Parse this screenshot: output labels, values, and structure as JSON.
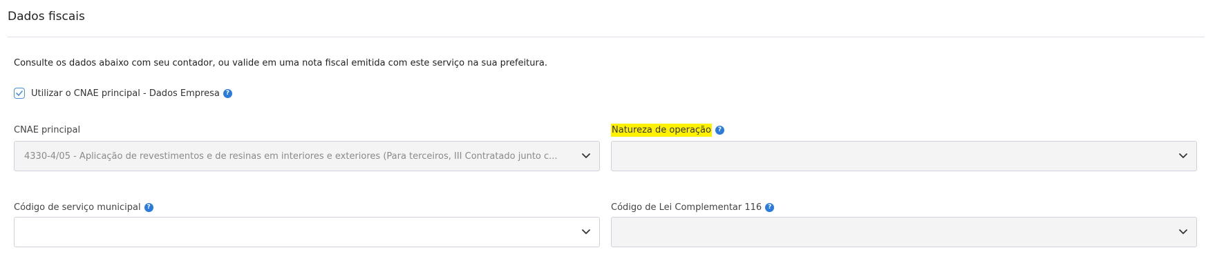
{
  "section": {
    "title": "Dados fiscais",
    "intro": "Consulte os dados abaixo com seu contador, ou valide em uma nota fiscal emitida com este serviço na sua prefeitura."
  },
  "cnae_checkbox": {
    "label": "Utilizar o CNAE principal - Dados Empresa",
    "checked": true
  },
  "fields": {
    "cnae_principal": {
      "label": "CNAE principal",
      "value": "4330-4/05 - Aplicação de revestimentos e de resinas em interiores e exteriores (Para terceiros, III Contratado junto c..."
    },
    "natureza_operacao": {
      "label": "Natureza de operação",
      "value": ""
    },
    "codigo_servico_municipal": {
      "label": "Código de serviço municipal",
      "value": ""
    },
    "codigo_lei_complementar": {
      "label": "Código de Lei Complementar 116",
      "value": ""
    }
  },
  "icons": {
    "help": "?",
    "help_color": "#2b7bdc",
    "checkbox_color": "#4d8fd6",
    "highlight_color": "#fff200"
  }
}
